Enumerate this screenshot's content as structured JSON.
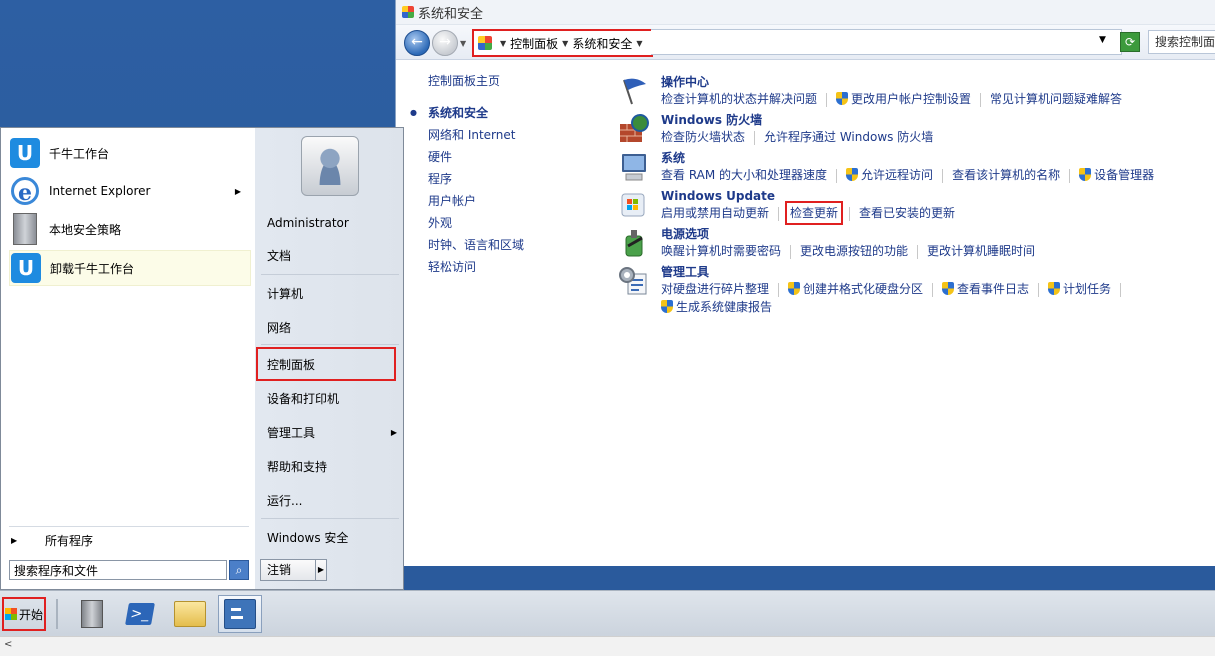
{
  "window": {
    "title": "系统和安全",
    "breadcrumb": [
      "控制面板",
      "系统和安全"
    ],
    "search_placeholder": "搜索控制面"
  },
  "sidebar": {
    "home": "控制面板主页",
    "items": [
      "系统和安全",
      "网络和 Internet",
      "硬件",
      "程序",
      "用户帐户",
      "外观",
      "时钟、语言和区域",
      "轻松访问"
    ]
  },
  "categories": [
    {
      "title": "操作中心",
      "icon": "flag-icon",
      "links": [
        {
          "text": "检查计算机的状态并解决问题"
        },
        {
          "text": "更改用户帐户控制设置",
          "shield": true
        },
        {
          "text": "常见计算机问题疑难解答"
        }
      ]
    },
    {
      "title": "Windows 防火墙",
      "icon": "firewall-icon",
      "links": [
        {
          "text": "检查防火墙状态"
        },
        {
          "text": "允许程序通过 Windows 防火墙"
        }
      ]
    },
    {
      "title": "系统",
      "icon": "system-icon",
      "links": [
        {
          "text": "查看 RAM 的大小和处理器速度"
        },
        {
          "text": "允许远程访问",
          "shield": true
        },
        {
          "text": "查看该计算机的名称"
        },
        {
          "text": "设备管理器",
          "shield": true
        }
      ]
    },
    {
      "title": "Windows Update",
      "icon": "windows-update-icon",
      "links": [
        {
          "text": "启用或禁用自动更新"
        },
        {
          "text": "检查更新",
          "highlight": true
        },
        {
          "text": "查看已安装的更新"
        }
      ]
    },
    {
      "title": "电源选项",
      "icon": "power-icon",
      "links": [
        {
          "text": "唤醒计算机时需要密码"
        },
        {
          "text": "更改电源按钮的功能"
        },
        {
          "text": "更改计算机睡眠时间"
        }
      ]
    },
    {
      "title": "管理工具",
      "icon": "admin-tools-icon",
      "links": [
        {
          "text": "对硬盘进行碎片整理"
        },
        {
          "text": "创建并格式化硬盘分区",
          "shield": true
        },
        {
          "text": "查看事件日志",
          "shield": true
        },
        {
          "text": "计划任务",
          "shield": true
        }
      ],
      "links2": [
        {
          "text": "生成系统健康报告",
          "shield": true
        }
      ]
    }
  ],
  "start_menu": {
    "programs": [
      "千牛工作台",
      "Internet Explorer",
      "本地安全策略",
      "卸载千牛工作台"
    ],
    "all_programs": "所有程序",
    "search_placeholder": "搜索程序和文件",
    "right_items": [
      "Administrator",
      "文档",
      "计算机",
      "网络",
      "控制面板",
      "设备和打印机",
      "管理工具",
      "帮助和支持",
      "运行...",
      "Windows 安全"
    ],
    "logout": "注销"
  },
  "taskbar": {
    "start_label": "开始",
    "buttons": [
      "server-manager-icon",
      "powershell-icon",
      "explorer-folder-icon",
      "control-panel-icon"
    ]
  }
}
